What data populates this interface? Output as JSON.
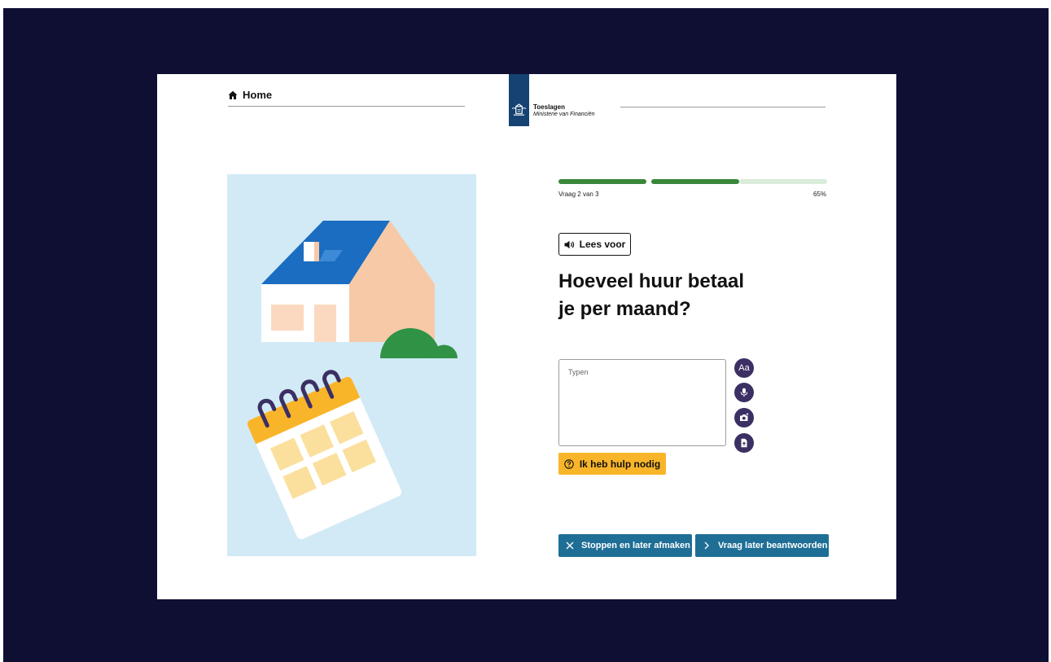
{
  "colors": {
    "backdrop": "#0e0f33",
    "progress_done": "#39873a",
    "progress_todo": "#d9ecd9",
    "tool_buttons": "#3b2f63",
    "help_button": "#f9b52a",
    "footer_buttons": "#1f6e96",
    "logo_bar": "#154273"
  },
  "header": {
    "home_label": "Home",
    "home_icon": "home-icon",
    "logo_title": "Toeslagen",
    "logo_subtitle": "Ministerie van Financiën"
  },
  "progress": {
    "label": "Vraag 2 van 3",
    "percent_label": "65%",
    "segments_total": 3,
    "segments_done": 2
  },
  "read_aloud": {
    "label": "Lees voor",
    "icon": "speaker-icon"
  },
  "question": {
    "line1": "Hoeveel huur betaal",
    "line2": "je per maand?"
  },
  "answer": {
    "placeholder": "Typen",
    "value": ""
  },
  "tools": [
    {
      "label": "Aa",
      "icon": "text-size-icon"
    },
    {
      "icon": "microphone-icon"
    },
    {
      "icon": "camera-icon"
    },
    {
      "icon": "upload-file-icon"
    }
  ],
  "help": {
    "label": "Ik heb hulp nodig",
    "icon": "question-circle-icon"
  },
  "footer": {
    "stop_label": "Stoppen en later afmaken",
    "stop_icon": "close-icon",
    "later_label": "Vraag later beantwoorden",
    "later_icon": "chevron-right-icon"
  }
}
